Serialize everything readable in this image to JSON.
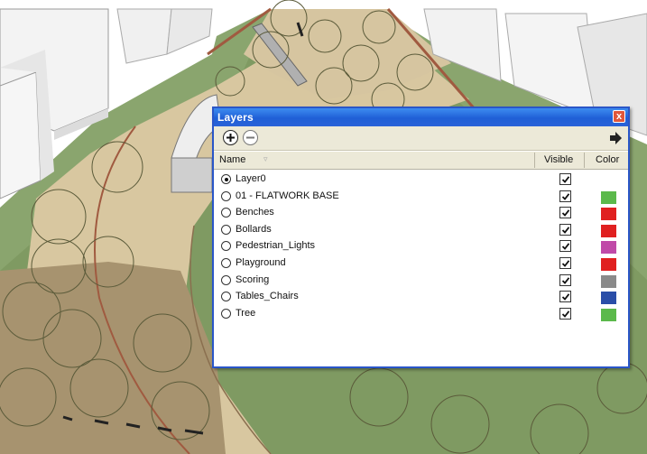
{
  "layers_panel": {
    "title": "Layers",
    "close_glyph": "x",
    "columns": {
      "name": "Name",
      "visible": "Visible",
      "color": "Color"
    },
    "toolbar": {
      "add_icon": "plus-circle-icon",
      "remove_icon": "minus-circle-icon",
      "details_icon": "arrow-right-icon"
    },
    "layers": [
      {
        "name": "Layer0",
        "active": true,
        "visible": true,
        "color": null
      },
      {
        "name": "01 - FLATWORK BASE",
        "active": false,
        "visible": true,
        "color": "#5bb94b"
      },
      {
        "name": "Benches",
        "active": false,
        "visible": true,
        "color": "#e02020"
      },
      {
        "name": "Bollards",
        "active": false,
        "visible": true,
        "color": "#e02020"
      },
      {
        "name": "Pedestrian_Lights",
        "active": false,
        "visible": true,
        "color": "#c04aa8"
      },
      {
        "name": "Playground",
        "active": false,
        "visible": true,
        "color": "#e02020"
      },
      {
        "name": "Scoring",
        "active": false,
        "visible": true,
        "color": "#8a8a8a"
      },
      {
        "name": "Tables_Chairs",
        "active": false,
        "visible": true,
        "color": "#2a4ea8"
      },
      {
        "name": "Tree",
        "active": false,
        "visible": true,
        "color": "#5bb94b"
      }
    ]
  }
}
